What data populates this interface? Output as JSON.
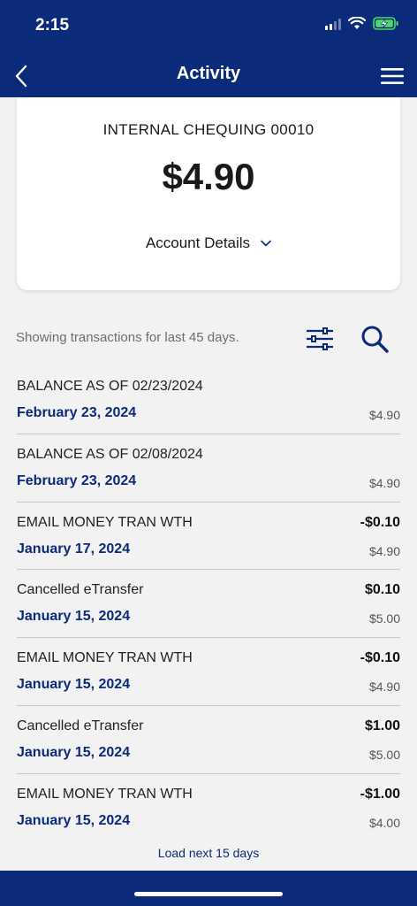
{
  "status_bar": {
    "time": "2:15"
  },
  "header": {
    "title": "Activity"
  },
  "account": {
    "name": "INTERNAL CHEQUING 00010",
    "balance": "$4.90",
    "details_label": "Account Details"
  },
  "filter": {
    "summary": "Showing transactions for last 45 days."
  },
  "transactions": [
    {
      "description": "BALANCE AS OF 02/23/2024",
      "date": "February 23, 2024",
      "amount": "",
      "balance": "$4.90"
    },
    {
      "description": "BALANCE AS OF 02/08/2024",
      "date": "February 23, 2024",
      "amount": "",
      "balance": "$4.90"
    },
    {
      "description": "EMAIL MONEY TRAN WTH",
      "date": "January 17, 2024",
      "amount": "-$0.10",
      "balance": "$4.90"
    },
    {
      "description": "Cancelled eTransfer",
      "date": "January 15, 2024",
      "amount": "$0.10",
      "balance": "$5.00"
    },
    {
      "description": "EMAIL MONEY TRAN WTH",
      "date": "January 15, 2024",
      "amount": "-$0.10",
      "balance": "$4.90"
    },
    {
      "description": "Cancelled eTransfer",
      "date": "January 15, 2024",
      "amount": "$1.00",
      "balance": "$5.00"
    },
    {
      "description": "EMAIL MONEY TRAN WTH",
      "date": "January 15, 2024",
      "amount": "-$1.00",
      "balance": "$4.00"
    }
  ],
  "load_more_label": "Load next 15 days",
  "colors": {
    "brand": "#0b2a7a",
    "background": "#f2f2f3",
    "battery": "#4cd964"
  },
  "icons": {
    "back": "chevron-left-icon",
    "menu": "hamburger-menu-icon",
    "details": "chevron-down-icon",
    "filter": "filter-sliders-icon",
    "search": "search-icon"
  }
}
